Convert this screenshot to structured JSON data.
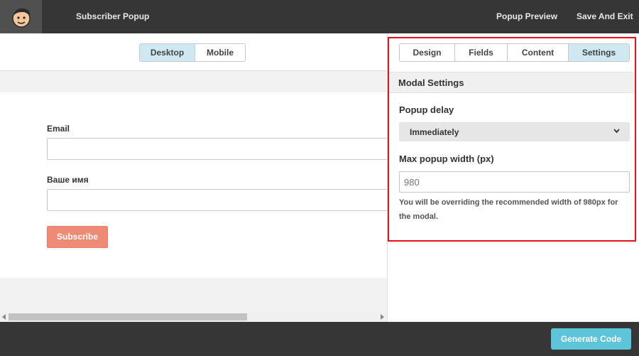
{
  "header": {
    "app_title": "Subscriber Popup",
    "popup_preview_label": "Popup Preview",
    "save_exit_label": "Save And Exit"
  },
  "preview": {
    "view_toggle": [
      "Desktop",
      "Mobile"
    ],
    "active_view": "Desktop",
    "form": {
      "email_label": "Email",
      "name_label": "Ваше имя",
      "subscribe_label": "Subscribe"
    }
  },
  "panel": {
    "tabs": [
      "Design",
      "Fields",
      "Content",
      "Settings"
    ],
    "active_tab": "Settings",
    "section_title": "Modal Settings",
    "popup_delay_label": "Popup delay",
    "popup_delay_value": "Immediately",
    "max_width_label": "Max popup width (px)",
    "max_width_placeholder": "980",
    "help_text": "You will be overriding the recommended width of 980px for the modal."
  },
  "footer": {
    "generate_label": "Generate Code"
  },
  "colors": {
    "topbar": "#363636",
    "active_tab": "#cfe9f3",
    "subscribe_button": "#ef8a74",
    "generate_button": "#5ec4d9",
    "highlight_border": "#e8101b"
  },
  "icons": {
    "logo": "mailchimp-logo-icon",
    "select_chevron": "chevron-down-icon"
  }
}
